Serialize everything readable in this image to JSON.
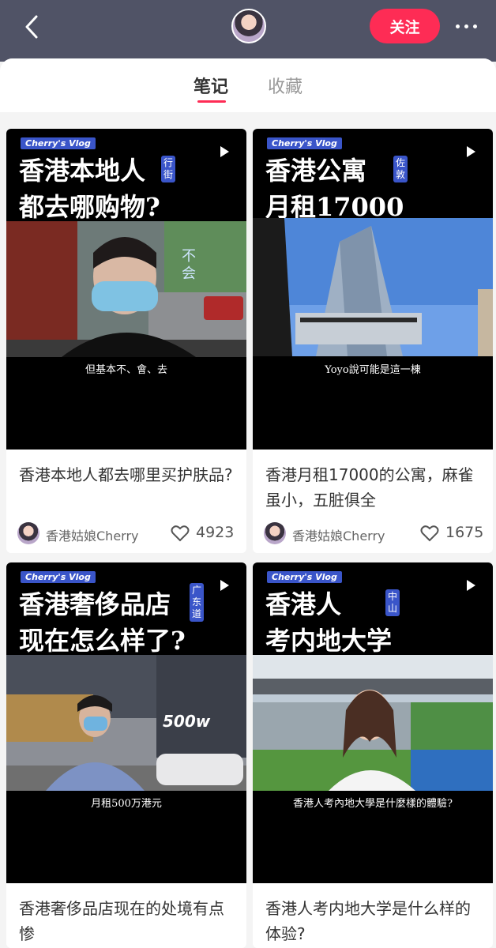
{
  "header": {
    "follow_label": "关注"
  },
  "tabs": [
    {
      "label": "笔记",
      "active": true
    },
    {
      "label": "收藏",
      "active": false
    }
  ],
  "notes": [
    {
      "vlog_tag": "Cherry's Vlog",
      "cover_title_line1": "香港本地人",
      "cover_title_line2": "都去哪购物?",
      "side_tag": "行街",
      "photo_overlay": "不会",
      "subtitle": "但基本不、會、去",
      "title": "香港本地人都去哪里买护肤品?",
      "author": "香港姑娘Cherry",
      "likes": "4923"
    },
    {
      "vlog_tag": "Cherry's Vlog",
      "cover_title_line1": "香港公寓",
      "cover_title_line2": "月租17000",
      "side_tag": "佐敦",
      "photo_overlay": "",
      "subtitle": "Yoyo說可能是這一棟",
      "title": "香港月租17000的公寓，麻雀虽小，五脏俱全",
      "author": "香港姑娘Cherry",
      "likes": "1675"
    },
    {
      "vlog_tag": "Cherry's Vlog",
      "cover_title_line1": "香港奢侈品店",
      "cover_title_line2": "现在怎么样了?",
      "side_tag": "广东道",
      "photo_overlay": "500w",
      "subtitle": "月租500万港元",
      "title": "香港奢侈品店现在的处境有点惨",
      "author": "",
      "likes": ""
    },
    {
      "vlog_tag": "Cherry's Vlog",
      "cover_title_line1": "香港人",
      "cover_title_line2": "考内地大学",
      "side_tag": "中山",
      "photo_overlay": "",
      "subtitle": "香港人考內地大學是什麼樣的體驗?",
      "title": "香港人考内地大学是什么样的体验?",
      "author": "",
      "likes": ""
    }
  ],
  "colors": {
    "header_bg": "#505366",
    "accent": "#fe2c55",
    "tag_blue": "#3a55c9"
  }
}
